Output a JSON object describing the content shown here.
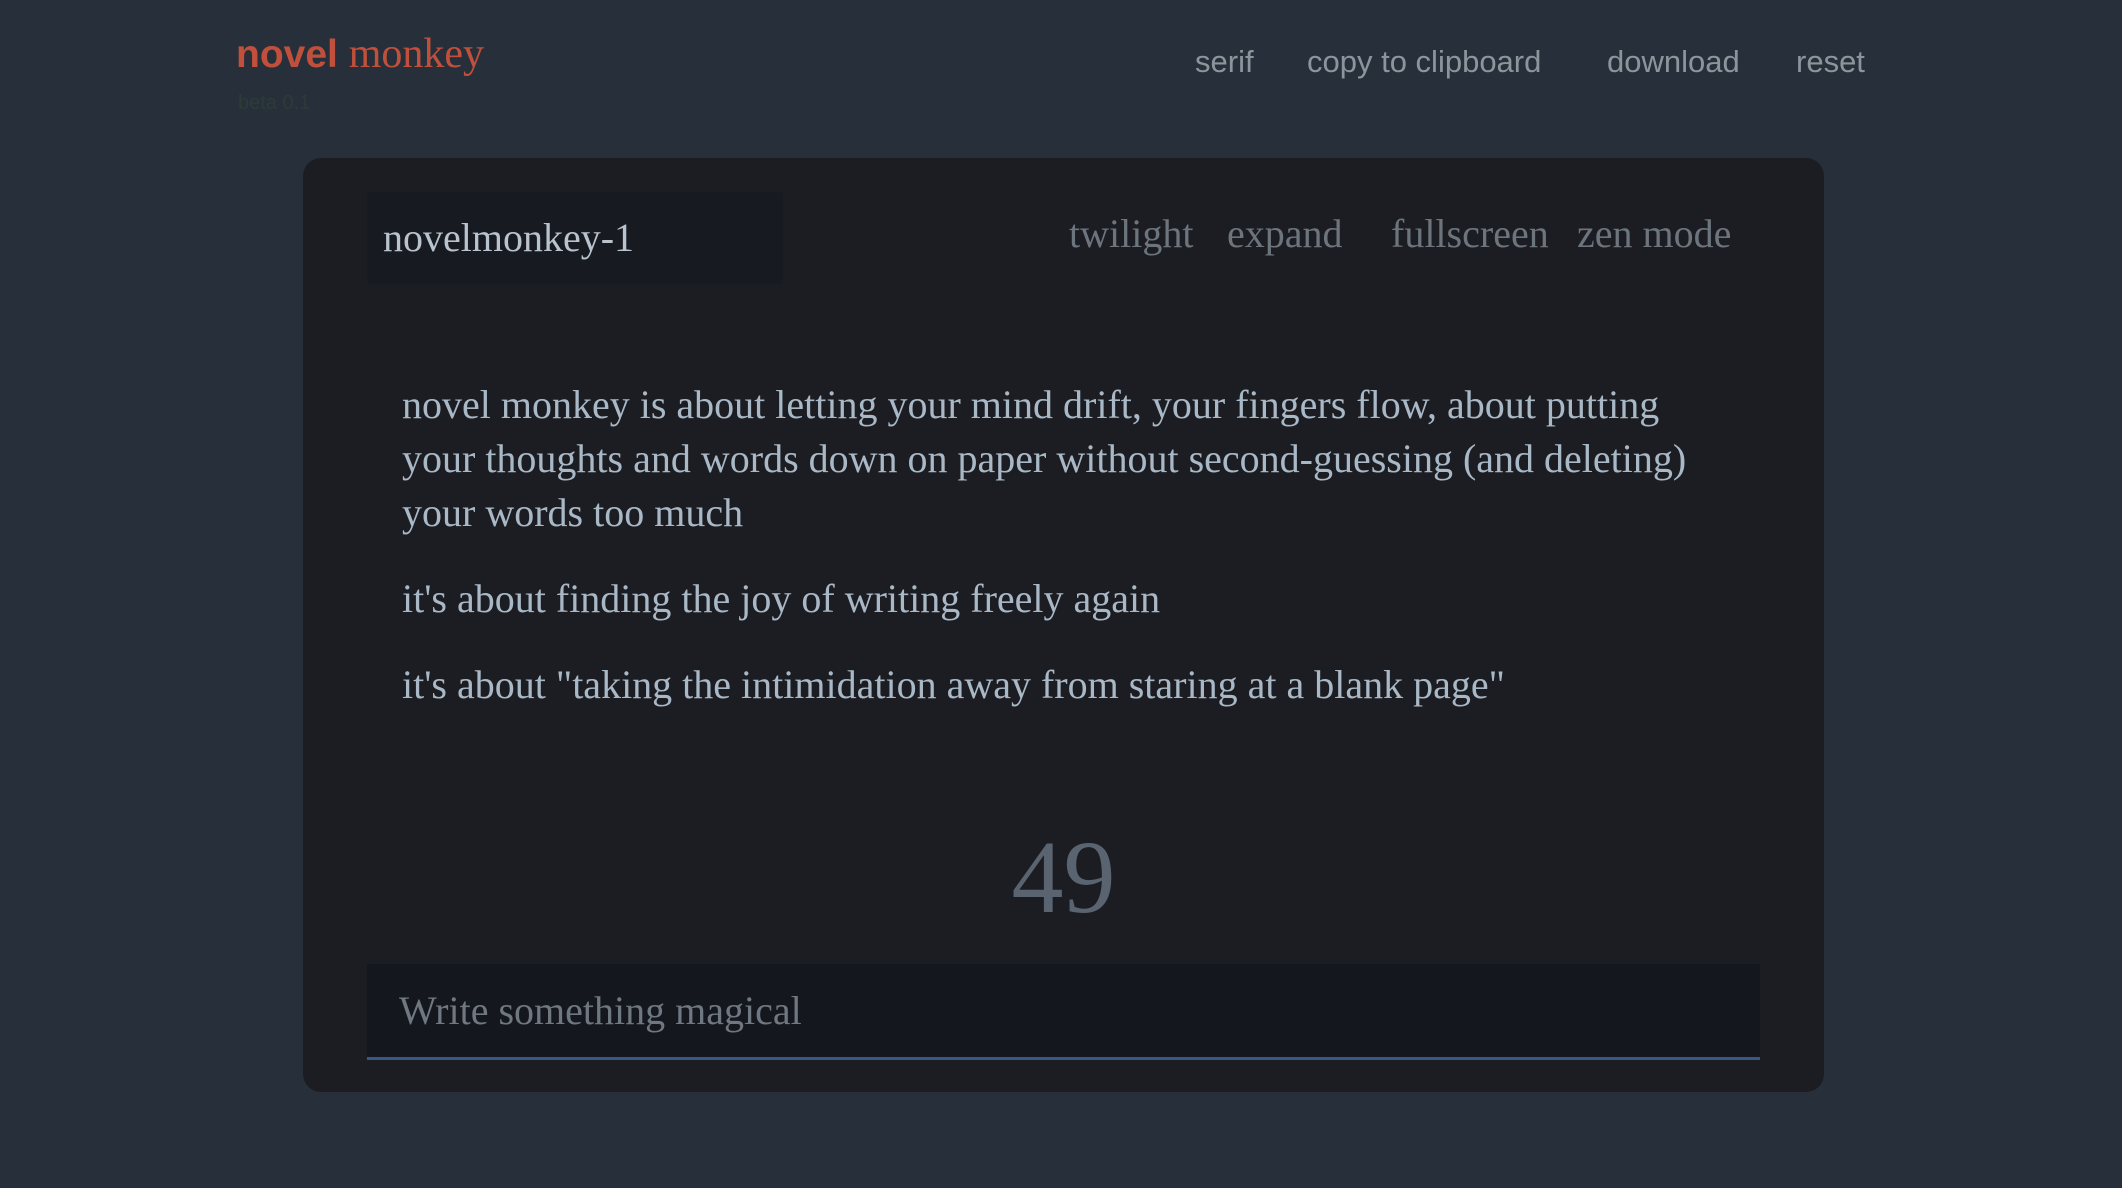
{
  "app": {
    "logo_novel": "novel",
    "logo_monkey": "monkey",
    "beta_label": "beta 0.1"
  },
  "topnav": {
    "font": "serif",
    "copy": "copy to clipboard",
    "download": "download",
    "reset": "reset"
  },
  "editor": {
    "title": "novelmonkey-1",
    "nav": {
      "theme": "twilight",
      "expand": "expand",
      "fullscreen": "fullscreen",
      "zen": "zen mode"
    },
    "paragraphs": [
      "novel monkey is about letting your mind drift, your fingers flow, about putting your thoughts and words down on paper without second-guessing (and deleting) your words too much",
      "it's about finding the joy of writing freely again",
      "it's about \"taking the intimidation away from staring at a blank page\""
    ],
    "word_count": "49",
    "input_placeholder": "Write something magical",
    "input_value": ""
  },
  "colors": {
    "background": "#27303a",
    "card": "#1c1d22",
    "accent": "#c0503c",
    "input_underline": "#3a5788"
  }
}
